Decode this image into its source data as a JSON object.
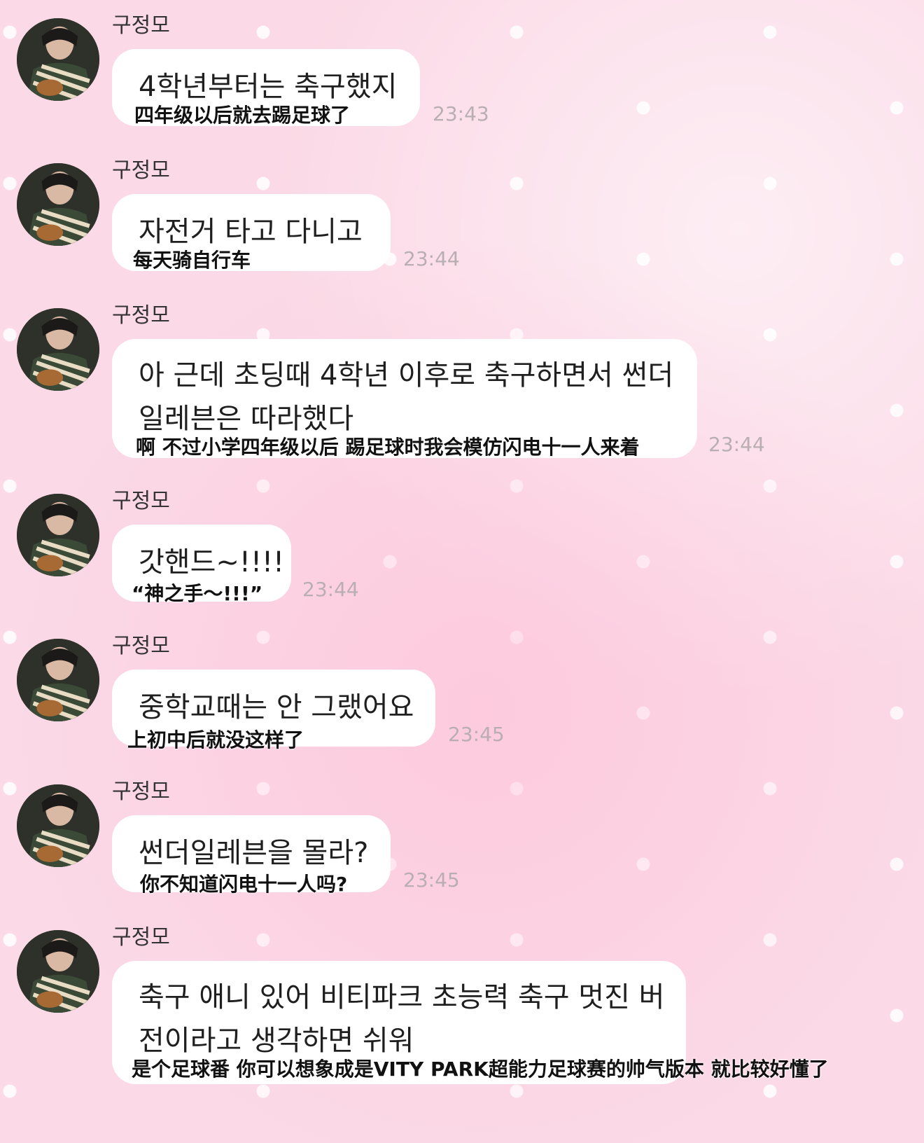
{
  "sender_name": "구정모",
  "messages": [
    {
      "text": "4학년부터는 축구했지",
      "translation": "四年级以后就去踢足球了",
      "time": "23:43"
    },
    {
      "text": "자전거 타고 다니고",
      "translation": "每天骑自行车",
      "time": "23:44"
    },
    {
      "text_line1": "아 근데 초딩때 4학년 이후로 축구하면서 썬더",
      "text_line2": "일레븐은 따라했다",
      "translation": "啊 不过小学四年级以后 踢足球时我会模仿闪电十一人来着",
      "time": "23:44"
    },
    {
      "text": "갓핸드~!!!!",
      "translation": "“神之手～!!!”",
      "time": "23:44"
    },
    {
      "text": "중학교때는 안 그랬어요",
      "translation": "上初中后就没这样了",
      "time": "23:45"
    },
    {
      "text": "썬더일레븐을 몰라?",
      "translation": "你不知道闪电十一人吗?",
      "time": "23:45"
    },
    {
      "text_line1": "축구 애니 있어 비티파크 초능력 축구 멋진 버",
      "text_line2": "전이라고 생각하면 쉬워",
      "translation": "是个足球番 你可以想象成是VITY PARK超能力足球赛的帅气版本 就比较好懂了"
    }
  ]
}
